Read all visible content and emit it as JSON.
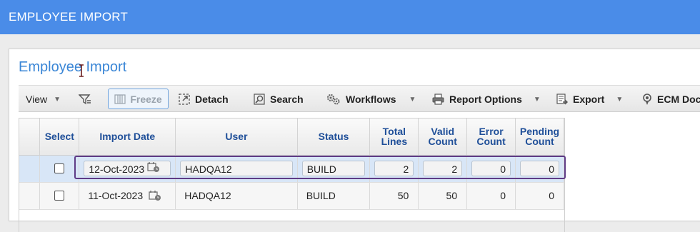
{
  "header": {
    "title": "EMPLOYEE IMPORT"
  },
  "page": {
    "title": "Employee Import"
  },
  "toolbar": {
    "view_label": "View",
    "freeze_label": "Freeze",
    "detach_label": "Detach",
    "search_label": "Search",
    "workflows_label": "Workflows",
    "report_options_label": "Report Options",
    "export_label": "Export",
    "ecm_label": "ECM Doc"
  },
  "grid": {
    "columns": {
      "select": "Select",
      "import_date": "Import Date",
      "user": "User",
      "status": "Status",
      "total_lines_1": "Total",
      "total_lines_2": "Lines",
      "valid_count_1": "Valid",
      "valid_count_2": "Count",
      "error_count_1": "Error",
      "error_count_2": "Count",
      "pending_count_1": "Pending",
      "pending_count_2": "Count"
    },
    "rows": [
      {
        "import_date": "12-Oct-2023",
        "user": "HADQA12",
        "status": "BUILD",
        "total_lines": "2",
        "valid_count": "2",
        "error_count": "0",
        "pending_count": "0"
      },
      {
        "import_date": "11-Oct-2023",
        "user": "HADQA12",
        "status": "BUILD",
        "total_lines": "50",
        "valid_count": "50",
        "error_count": "0",
        "pending_count": "0"
      }
    ]
  },
  "colors": {
    "header_bg": "#4a8ce8",
    "title_blue": "#3a86d6",
    "column_header_text": "#1f4f99",
    "selected_row_bg": "#d8e6f7",
    "highlight_border": "#5f3b86"
  }
}
